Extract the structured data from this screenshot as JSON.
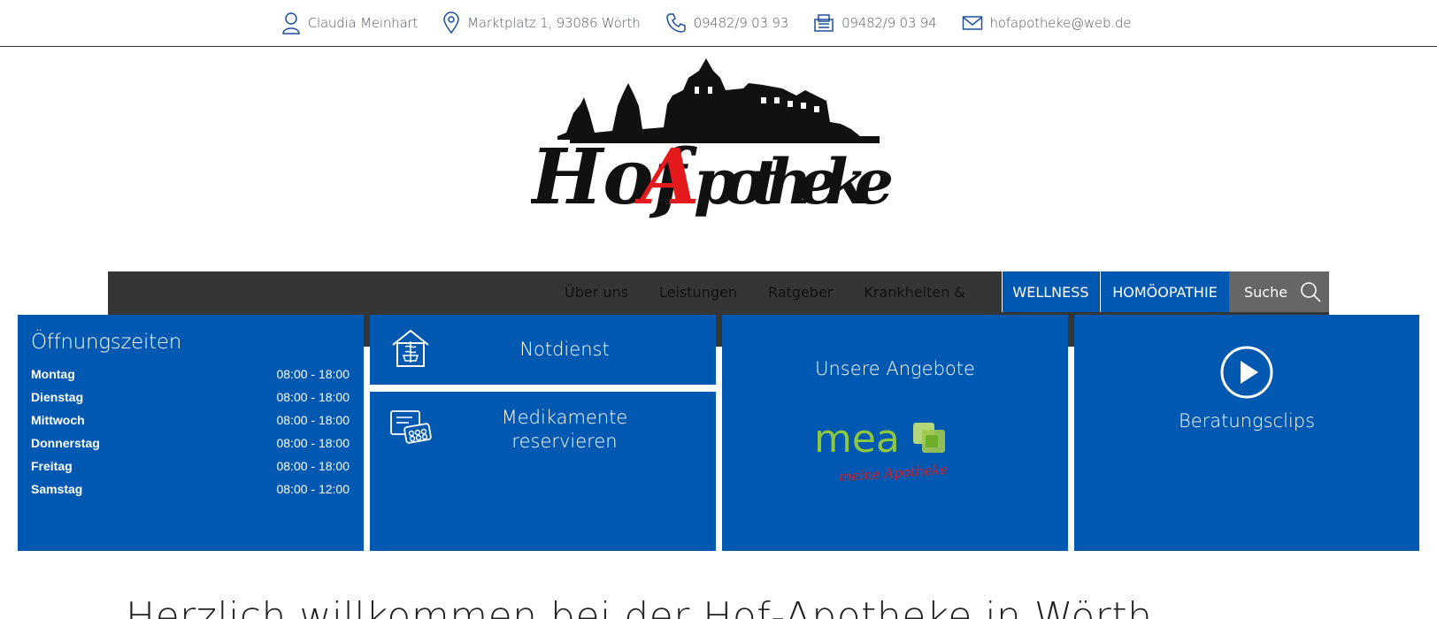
{
  "contact_bar": {
    "name": "Claudia Meinhart",
    "address": "Marktplatz 1, 93086 Wörth",
    "phone": "09482/9 03 93",
    "fax": "09482/9 03 94",
    "email": "hofapotheke@web.de"
  },
  "logo": {
    "word_left": "Hof",
    "word_accent": "A",
    "word_right": "potheke",
    "accent_color": "#e3191c"
  },
  "nav": {
    "links": [
      "Über uns",
      "Leistungen",
      "Ratgeber",
      "Krankheiten &"
    ],
    "wellness": "WELLNESS",
    "homoeopathie": "HOMÖOPATHIE",
    "search": "Suche"
  },
  "hours": {
    "title": "Öffnungszeiten",
    "rows": [
      {
        "day": "Montag",
        "time": "08:00 - 18:00"
      },
      {
        "day": "Dienstag",
        "time": "08:00 - 18:00"
      },
      {
        "day": "Mittwoch",
        "time": "08:00 - 18:00"
      },
      {
        "day": "Donnerstag",
        "time": "08:00 - 18:00"
      },
      {
        "day": "Freitag",
        "time": "08:00 - 18:00"
      },
      {
        "day": "Samstag",
        "time": "08:00 - 12:00"
      }
    ]
  },
  "tiles": {
    "notdienst": "Notdienst",
    "medikamente_line1": "Medikamente",
    "medikamente_line2": "reservieren",
    "angebote": "Unsere Angebote",
    "mea_text": "mea",
    "mea_script": "meine Apotheke",
    "clips": "Beratungsclips"
  },
  "welcome": "Herzlich willkommen bei der Hof-Apotheke in Wörth",
  "colors": {
    "brand_blue": "#0058b0",
    "nav_dark": "#353535",
    "search_grey": "#666666",
    "mea_green": "#8dc63f"
  }
}
